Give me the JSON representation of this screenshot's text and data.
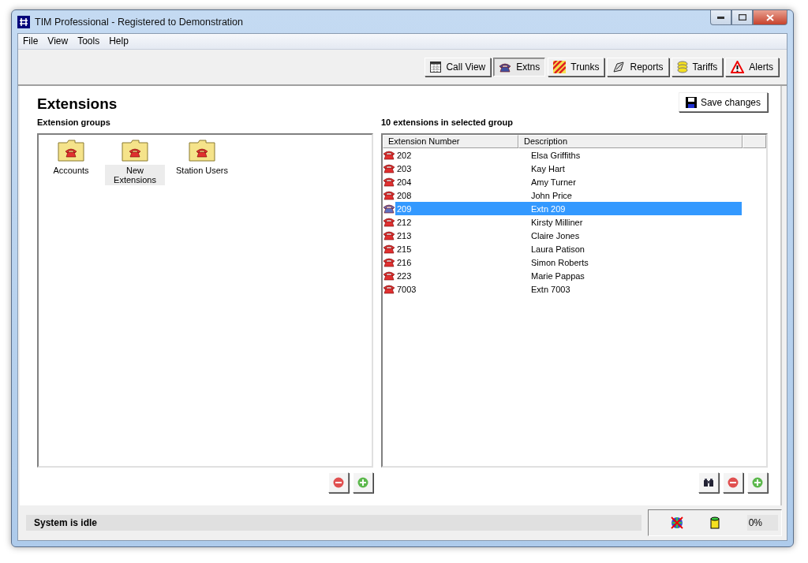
{
  "window": {
    "title": "TIM Professional - Registered to Demonstration"
  },
  "menu": [
    "File",
    "View",
    "Tools",
    "Help"
  ],
  "toolbar": [
    {
      "label": "Call View",
      "kind": "grid",
      "selected": false
    },
    {
      "label": "Extns",
      "kind": "phone",
      "selected": true
    },
    {
      "label": "Trunks",
      "kind": "stripes",
      "selected": false
    },
    {
      "label": "Reports",
      "kind": "pen",
      "selected": false
    },
    {
      "label": "Tariffs",
      "kind": "coins",
      "selected": false
    },
    {
      "label": "Alerts",
      "kind": "warning",
      "selected": false
    }
  ],
  "page": {
    "title": "Extensions",
    "save_button": "Save changes"
  },
  "groups_panel": {
    "heading": "Extension groups",
    "groups": [
      {
        "label": "Accounts",
        "selected": false
      },
      {
        "label": "New Extensions",
        "selected": true
      },
      {
        "label": "Station Users",
        "selected": false
      }
    ]
  },
  "extensions_panel": {
    "heading": "10 extensions in selected group",
    "columns": [
      "Extension Number",
      "Description"
    ],
    "rows": [
      {
        "number": "202",
        "description": "Elsa Griffiths",
        "selected": false
      },
      {
        "number": "203",
        "description": "Kay Hart",
        "selected": false
      },
      {
        "number": "204",
        "description": "Amy Turner",
        "selected": false
      },
      {
        "number": "208",
        "description": "John Price",
        "selected": false
      },
      {
        "number": "209",
        "description": "Extn 209",
        "selected": true
      },
      {
        "number": "212",
        "description": "Kirsty Milliner",
        "selected": false
      },
      {
        "number": "213",
        "description": "Claire Jones",
        "selected": false
      },
      {
        "number": "215",
        "description": "Laura Patison",
        "selected": false
      },
      {
        "number": "216",
        "description": "Simon Roberts",
        "selected": false
      },
      {
        "number": "223",
        "description": "Marie Pappas",
        "selected": false
      },
      {
        "number": "7003",
        "description": "Extn 7003",
        "selected": false
      }
    ]
  },
  "status_bar": {
    "message": "System is idle",
    "usage": "0%"
  }
}
